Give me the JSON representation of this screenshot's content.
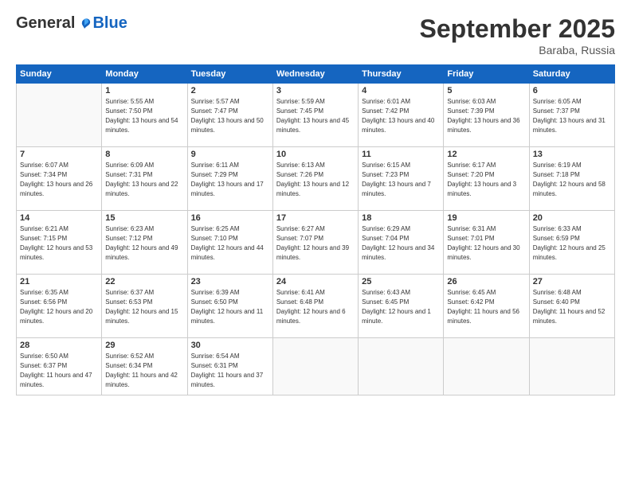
{
  "header": {
    "logo_general": "General",
    "logo_blue": "Blue",
    "month_title": "September 2025",
    "location": "Baraba, Russia"
  },
  "days_of_week": [
    "Sunday",
    "Monday",
    "Tuesday",
    "Wednesday",
    "Thursday",
    "Friday",
    "Saturday"
  ],
  "weeks": [
    [
      {
        "day": "",
        "sunrise": "",
        "sunset": "",
        "daylight": ""
      },
      {
        "day": "1",
        "sunrise": "Sunrise: 5:55 AM",
        "sunset": "Sunset: 7:50 PM",
        "daylight": "Daylight: 13 hours and 54 minutes."
      },
      {
        "day": "2",
        "sunrise": "Sunrise: 5:57 AM",
        "sunset": "Sunset: 7:47 PM",
        "daylight": "Daylight: 13 hours and 50 minutes."
      },
      {
        "day": "3",
        "sunrise": "Sunrise: 5:59 AM",
        "sunset": "Sunset: 7:45 PM",
        "daylight": "Daylight: 13 hours and 45 minutes."
      },
      {
        "day": "4",
        "sunrise": "Sunrise: 6:01 AM",
        "sunset": "Sunset: 7:42 PM",
        "daylight": "Daylight: 13 hours and 40 minutes."
      },
      {
        "day": "5",
        "sunrise": "Sunrise: 6:03 AM",
        "sunset": "Sunset: 7:39 PM",
        "daylight": "Daylight: 13 hours and 36 minutes."
      },
      {
        "day": "6",
        "sunrise": "Sunrise: 6:05 AM",
        "sunset": "Sunset: 7:37 PM",
        "daylight": "Daylight: 13 hours and 31 minutes."
      }
    ],
    [
      {
        "day": "7",
        "sunrise": "Sunrise: 6:07 AM",
        "sunset": "Sunset: 7:34 PM",
        "daylight": "Daylight: 13 hours and 26 minutes."
      },
      {
        "day": "8",
        "sunrise": "Sunrise: 6:09 AM",
        "sunset": "Sunset: 7:31 PM",
        "daylight": "Daylight: 13 hours and 22 minutes."
      },
      {
        "day": "9",
        "sunrise": "Sunrise: 6:11 AM",
        "sunset": "Sunset: 7:29 PM",
        "daylight": "Daylight: 13 hours and 17 minutes."
      },
      {
        "day": "10",
        "sunrise": "Sunrise: 6:13 AM",
        "sunset": "Sunset: 7:26 PM",
        "daylight": "Daylight: 13 hours and 12 minutes."
      },
      {
        "day": "11",
        "sunrise": "Sunrise: 6:15 AM",
        "sunset": "Sunset: 7:23 PM",
        "daylight": "Daylight: 13 hours and 7 minutes."
      },
      {
        "day": "12",
        "sunrise": "Sunrise: 6:17 AM",
        "sunset": "Sunset: 7:20 PM",
        "daylight": "Daylight: 13 hours and 3 minutes."
      },
      {
        "day": "13",
        "sunrise": "Sunrise: 6:19 AM",
        "sunset": "Sunset: 7:18 PM",
        "daylight": "Daylight: 12 hours and 58 minutes."
      }
    ],
    [
      {
        "day": "14",
        "sunrise": "Sunrise: 6:21 AM",
        "sunset": "Sunset: 7:15 PM",
        "daylight": "Daylight: 12 hours and 53 minutes."
      },
      {
        "day": "15",
        "sunrise": "Sunrise: 6:23 AM",
        "sunset": "Sunset: 7:12 PM",
        "daylight": "Daylight: 12 hours and 49 minutes."
      },
      {
        "day": "16",
        "sunrise": "Sunrise: 6:25 AM",
        "sunset": "Sunset: 7:10 PM",
        "daylight": "Daylight: 12 hours and 44 minutes."
      },
      {
        "day": "17",
        "sunrise": "Sunrise: 6:27 AM",
        "sunset": "Sunset: 7:07 PM",
        "daylight": "Daylight: 12 hours and 39 minutes."
      },
      {
        "day": "18",
        "sunrise": "Sunrise: 6:29 AM",
        "sunset": "Sunset: 7:04 PM",
        "daylight": "Daylight: 12 hours and 34 minutes."
      },
      {
        "day": "19",
        "sunrise": "Sunrise: 6:31 AM",
        "sunset": "Sunset: 7:01 PM",
        "daylight": "Daylight: 12 hours and 30 minutes."
      },
      {
        "day": "20",
        "sunrise": "Sunrise: 6:33 AM",
        "sunset": "Sunset: 6:59 PM",
        "daylight": "Daylight: 12 hours and 25 minutes."
      }
    ],
    [
      {
        "day": "21",
        "sunrise": "Sunrise: 6:35 AM",
        "sunset": "Sunset: 6:56 PM",
        "daylight": "Daylight: 12 hours and 20 minutes."
      },
      {
        "day": "22",
        "sunrise": "Sunrise: 6:37 AM",
        "sunset": "Sunset: 6:53 PM",
        "daylight": "Daylight: 12 hours and 15 minutes."
      },
      {
        "day": "23",
        "sunrise": "Sunrise: 6:39 AM",
        "sunset": "Sunset: 6:50 PM",
        "daylight": "Daylight: 12 hours and 11 minutes."
      },
      {
        "day": "24",
        "sunrise": "Sunrise: 6:41 AM",
        "sunset": "Sunset: 6:48 PM",
        "daylight": "Daylight: 12 hours and 6 minutes."
      },
      {
        "day": "25",
        "sunrise": "Sunrise: 6:43 AM",
        "sunset": "Sunset: 6:45 PM",
        "daylight": "Daylight: 12 hours and 1 minute."
      },
      {
        "day": "26",
        "sunrise": "Sunrise: 6:45 AM",
        "sunset": "Sunset: 6:42 PM",
        "daylight": "Daylight: 11 hours and 56 minutes."
      },
      {
        "day": "27",
        "sunrise": "Sunrise: 6:48 AM",
        "sunset": "Sunset: 6:40 PM",
        "daylight": "Daylight: 11 hours and 52 minutes."
      }
    ],
    [
      {
        "day": "28",
        "sunrise": "Sunrise: 6:50 AM",
        "sunset": "Sunset: 6:37 PM",
        "daylight": "Daylight: 11 hours and 47 minutes."
      },
      {
        "day": "29",
        "sunrise": "Sunrise: 6:52 AM",
        "sunset": "Sunset: 6:34 PM",
        "daylight": "Daylight: 11 hours and 42 minutes."
      },
      {
        "day": "30",
        "sunrise": "Sunrise: 6:54 AM",
        "sunset": "Sunset: 6:31 PM",
        "daylight": "Daylight: 11 hours and 37 minutes."
      },
      {
        "day": "",
        "sunrise": "",
        "sunset": "",
        "daylight": ""
      },
      {
        "day": "",
        "sunrise": "",
        "sunset": "",
        "daylight": ""
      },
      {
        "day": "",
        "sunrise": "",
        "sunset": "",
        "daylight": ""
      },
      {
        "day": "",
        "sunrise": "",
        "sunset": "",
        "daylight": ""
      }
    ]
  ]
}
